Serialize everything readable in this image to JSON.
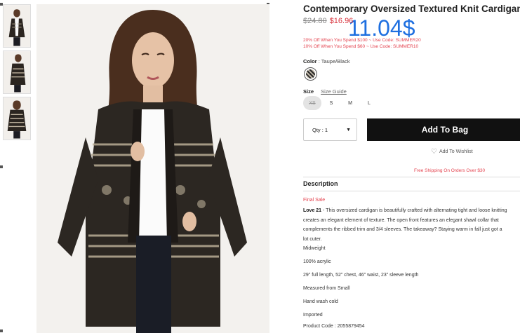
{
  "product": {
    "title": "Contemporary Oversized Textured Knit Cardigan",
    "old_price": "$24.80",
    "new_price": "$16.96",
    "overlay_price": "11.04$",
    "promos": [
      "20% Off When You Spend $100 ~ Use Code: SUMMER20",
      "10% Off When You Spend $60 ~ Use Code: SUMMER10"
    ],
    "color_label": "Color",
    "color_value": ": Taupe/Black",
    "size_label": "Size",
    "size_guide": "Size Guide",
    "sizes": [
      "XS",
      "S",
      "M",
      "L"
    ],
    "qty_label": "Qty : 1",
    "qty_arrow": "▼",
    "add_to_bag": "Add To Bag",
    "wishlist": "Add To Wishlist",
    "free_shipping": "Free Shipping On Orders Over $30"
  },
  "description": {
    "heading": "Description",
    "final_sale": "Final Sale",
    "brand": "Love 21",
    "body_lines": [
      " - This oversized cardigan is beautifully crafted with alternating tight and loose knitting",
      "creates an elegant element of texture. The open front features an elegant shawl collar that",
      "complements the ribbed trim and 3/4 sleeves. The takeaway? Staying warm in fall just got a",
      "lot cuter."
    ],
    "specs": [
      "Midweight",
      "100% acrylic",
      "29\" full length, 52\" chest, 46\" waist, 23\" sleeve length",
      "Measured from Small",
      "Hand wash cold",
      "Imported",
      "Product Code : 2055879454"
    ]
  },
  "icons": {
    "heart": "heart-icon",
    "dropdown": "chevron-down-icon"
  },
  "colors": {
    "sale_red": "#e4434f",
    "overlay_blue": "#1e6fe0",
    "button_black": "#111111"
  }
}
